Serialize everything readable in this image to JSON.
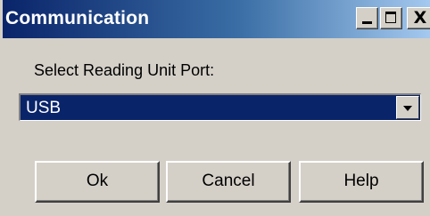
{
  "window": {
    "title": "Communication",
    "caption_buttons": {
      "minimize_icon": "minimize-icon",
      "maximize_icon": "maximize-icon",
      "close_icon": "close-icon",
      "close_glyph": "X"
    }
  },
  "form": {
    "port_label": "Select Reading Unit Port:",
    "port_selected": "USB",
    "dropdown_icon": "dropdown-arrow-icon"
  },
  "buttons": {
    "ok_label": "Ok",
    "cancel_label": "Cancel",
    "help_label": "Help"
  },
  "colors": {
    "title_bar_start": "#0a246a",
    "title_bar_end": "#a6caf0",
    "window_face": "#d4d0c8",
    "selection": "#0a246a"
  }
}
